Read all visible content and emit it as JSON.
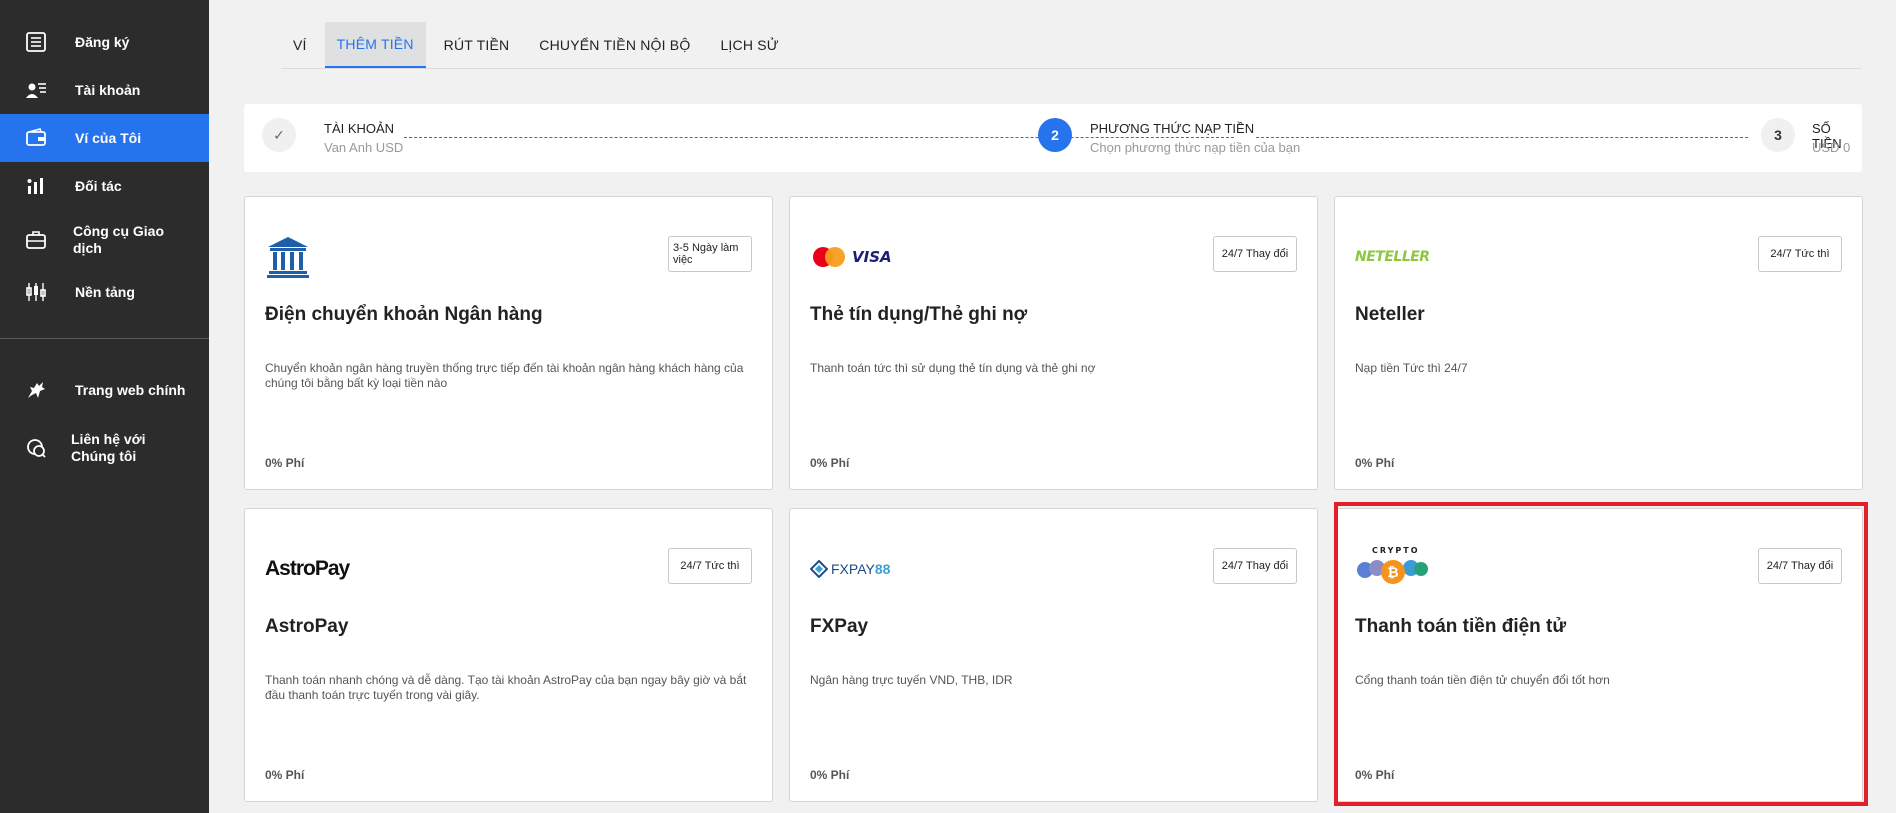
{
  "sidebar": {
    "items": [
      {
        "label": "Đăng ký",
        "icon": "register-list-icon"
      },
      {
        "label": "Tài khoản",
        "icon": "account-user-icon"
      },
      {
        "label": "Ví của Tôi",
        "icon": "wallet-icon"
      },
      {
        "label": "Đối tác",
        "icon": "partner-chart-icon"
      },
      {
        "label": "Công cụ Giao dịch",
        "icon": "briefcase-icon"
      },
      {
        "label": "Nền tảng",
        "icon": "candlestick-icon"
      },
      {
        "label": "Trang web chính",
        "icon": "bull-icon"
      },
      {
        "label": "Liên hệ với Chúng tôi",
        "icon": "chat-bubble-icon"
      }
    ],
    "active_index": 2
  },
  "tabs": [
    "VÍ",
    "THÊM TIỀN",
    "RÚT TIỀN",
    "CHUYỂN TIỀN NỘI BỘ",
    "LỊCH SỬ"
  ],
  "active_tab": 1,
  "stepper": {
    "steps": [
      {
        "title": "TÀI KHOẢN",
        "subtitle": "Van Anh USD",
        "state": "done",
        "marker": "✓"
      },
      {
        "title": "PHƯƠNG THỨC NẠP TIỀN",
        "subtitle": "Chọn phương thức nạp tiền của bạn",
        "state": "current",
        "marker": "2"
      },
      {
        "title": "SỐ TIỀN",
        "subtitle": "USD 0",
        "state": "pending",
        "marker": "3"
      }
    ]
  },
  "methods": [
    {
      "title": "Điện chuyển khoản Ngân hàng",
      "badge": "3-5 Ngày làm việc",
      "description": "Chuyển khoản ngân hàng truyền thống trực tiếp đến tài khoản ngân hàng khách hàng của chúng tôi bằng bất kỳ loại tiền nào",
      "fee": "0% Phí",
      "logo": "bank-building-icon"
    },
    {
      "title": "Thẻ tín dụng/Thẻ ghi nợ",
      "badge": "24/7 Thay đổi",
      "description": "Thanh toán tức thì sử dụng thẻ tín dụng và thẻ ghi nợ",
      "fee": "0% Phí",
      "logo": "mastercard-visa-logo",
      "logo_text": "VISA"
    },
    {
      "title": "Neteller",
      "badge": "24/7 Tức thì",
      "description": "Nạp tiền Tức thì 24/7",
      "fee": "0% Phí",
      "logo": "neteller-logo",
      "logo_text": "NETELLER"
    },
    {
      "title": "AstroPay",
      "badge": "24/7 Tức thì",
      "description": "Thanh toán nhanh chóng và dễ dàng. Tạo tài khoản AstroPay của bạn ngay bây giờ và bắt đầu thanh toán trực tuyến trong vài giây.",
      "fee": "0% Phí",
      "logo": "astropay-logo",
      "logo_text": "AstroPay"
    },
    {
      "title": "FXPay",
      "badge": "24/7 Thay đổi",
      "description": "Ngân hàng trực tuyến VND, THB, IDR",
      "fee": "0% Phí",
      "logo": "fxpay88-logo",
      "logo_text_a": "FXPAY",
      "logo_text_b": "88"
    },
    {
      "title": "Thanh toán tiền điện tử",
      "badge": "24/7 Thay đổi",
      "description": "Cổng thanh toán tiền điện tử chuyển đổi tốt hơn",
      "fee": "0% Phí",
      "logo": "crypto-coins-logo",
      "logo_text": "CRYPTO"
    }
  ],
  "colors": {
    "sidebar_bg": "#2c2c2c",
    "accent": "#2673ee",
    "highlight": "#e0202a",
    "bank_blue": "#1d5fa8",
    "neteller_green": "#8dc63f"
  }
}
